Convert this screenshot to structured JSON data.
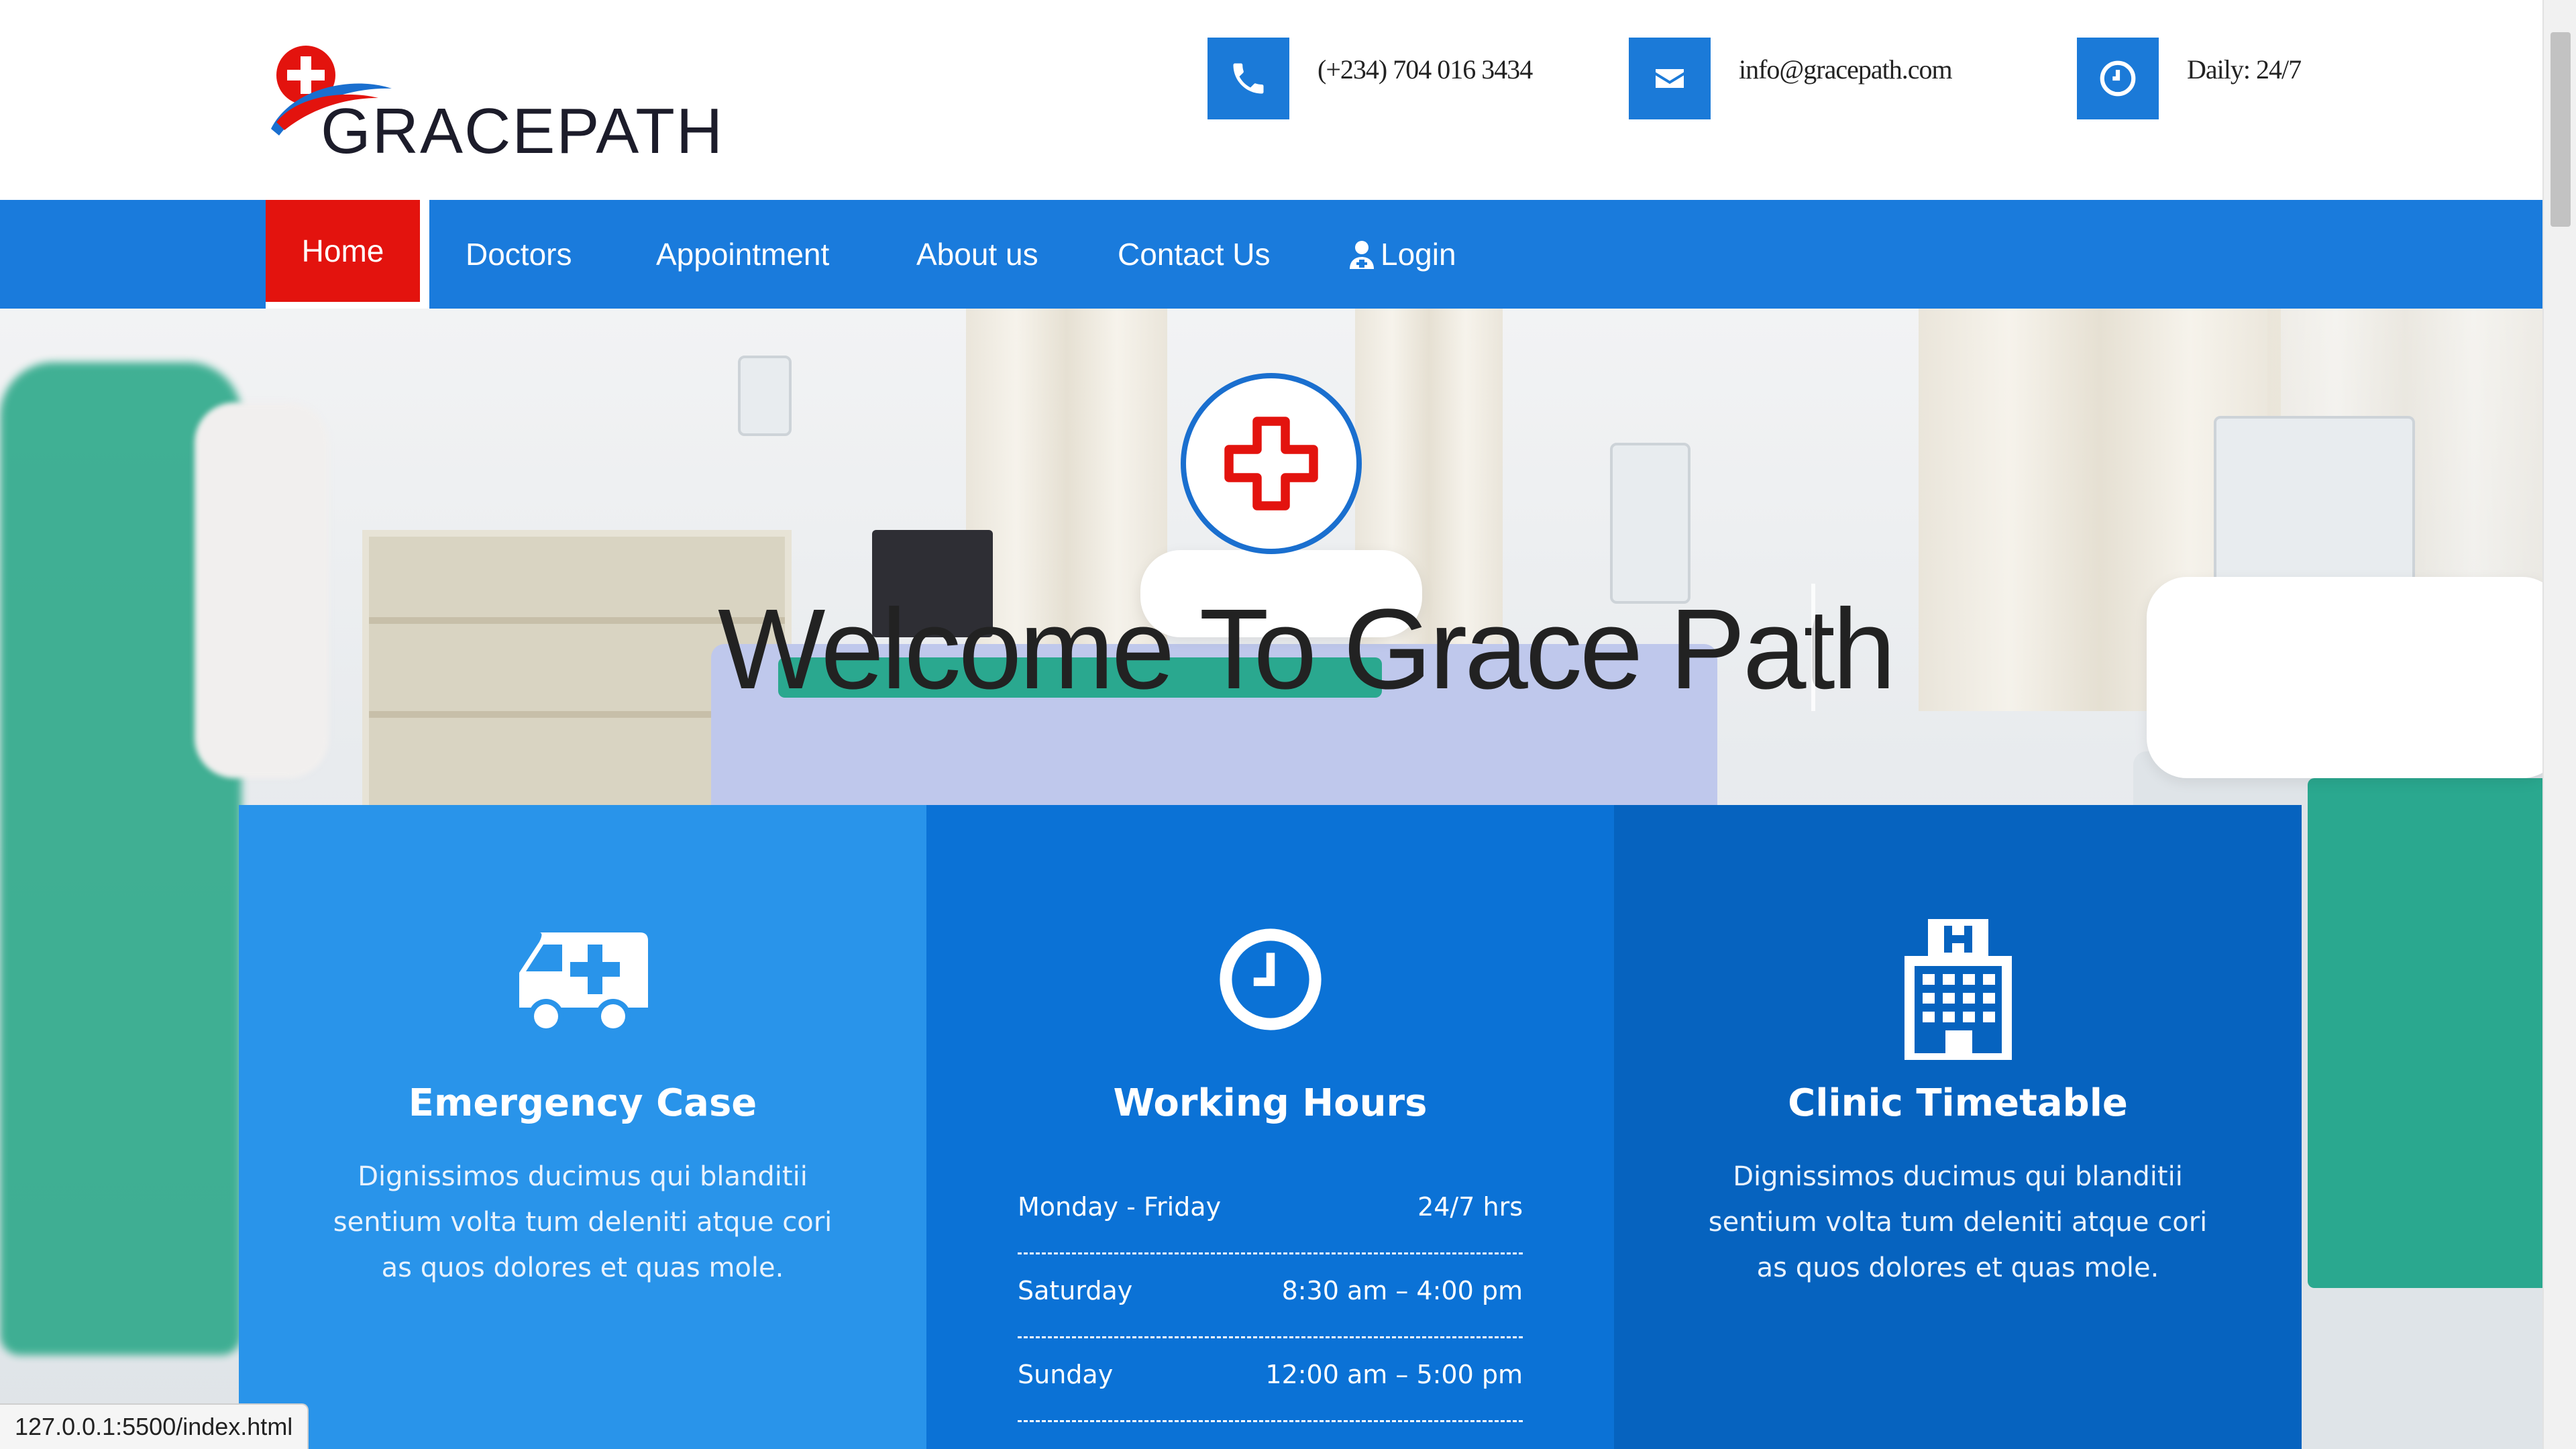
{
  "brand": {
    "name": "GRACEPATH",
    "accent": "#1a7bdc",
    "red": "#e3130e"
  },
  "topbar": {
    "phone": {
      "icon": "phone-icon",
      "text": "(+234) 704 016 3434"
    },
    "email": {
      "icon": "envelope-icon",
      "text": "info@gracepath.com"
    },
    "hours": {
      "icon": "clock-icon",
      "text": "Daily: 24/7"
    }
  },
  "nav": {
    "items": [
      {
        "label": "Home",
        "active": true
      },
      {
        "label": "Doctors"
      },
      {
        "label": "Appointment"
      },
      {
        "label": "About us"
      },
      {
        "label": "Contact Us"
      },
      {
        "label": "Login",
        "icon": "user-doctor-icon"
      }
    ]
  },
  "hero": {
    "badge_icon": "medical-cross-icon",
    "title": "Welcome To Grace Path"
  },
  "cards": [
    {
      "icon": "ambulance-icon",
      "title": "Emergency Case",
      "text": "Dignissimos ducimus qui blanditii sentium volta tum deleniti atque cori as quos dolores et quas mole.",
      "color": "#2994ea"
    },
    {
      "icon": "clock-icon",
      "title": "Working Hours",
      "rows": [
        {
          "day": "Monday - Friday",
          "time": "24/7 hrs"
        },
        {
          "day": "Saturday",
          "time": "8:30 am – 4:00 pm"
        },
        {
          "day": "Sunday",
          "time": "12:00 am – 5:00 pm"
        }
      ],
      "color": "#0b72d6"
    },
    {
      "icon": "hospital-icon",
      "title": "Clinic Timetable",
      "text": "Dignissimos ducimus qui blanditii sentium volta tum deleniti atque cori as quos dolores et quas mole.",
      "color": "#0663bf"
    }
  ],
  "status_url": "127.0.0.1:5500/index.html"
}
